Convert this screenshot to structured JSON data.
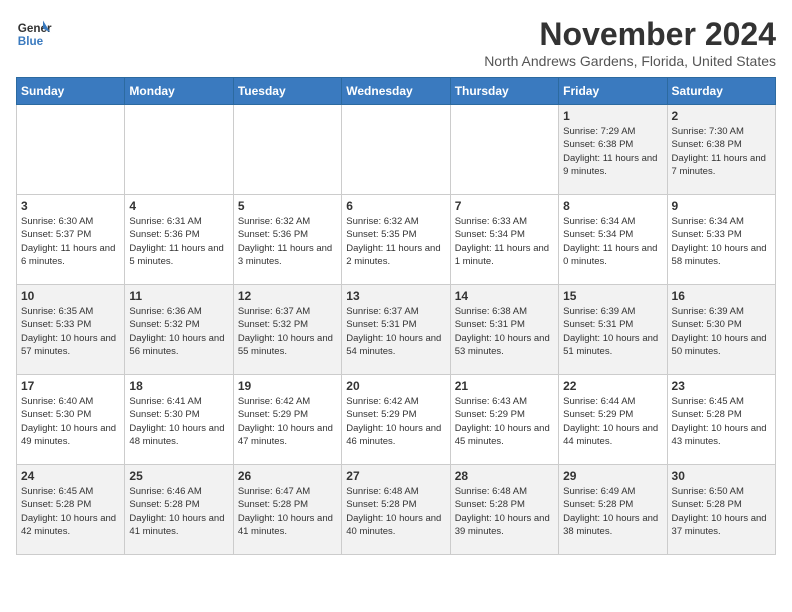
{
  "logo": {
    "line1": "General",
    "line2": "Blue"
  },
  "title": "November 2024",
  "subtitle": "North Andrews Gardens, Florida, United States",
  "days_of_week": [
    "Sunday",
    "Monday",
    "Tuesday",
    "Wednesday",
    "Thursday",
    "Friday",
    "Saturday"
  ],
  "weeks": [
    [
      {
        "day": "",
        "info": ""
      },
      {
        "day": "",
        "info": ""
      },
      {
        "day": "",
        "info": ""
      },
      {
        "day": "",
        "info": ""
      },
      {
        "day": "",
        "info": ""
      },
      {
        "day": "1",
        "info": "Sunrise: 7:29 AM\nSunset: 6:38 PM\nDaylight: 11 hours and 9 minutes."
      },
      {
        "day": "2",
        "info": "Sunrise: 7:30 AM\nSunset: 6:38 PM\nDaylight: 11 hours and 7 minutes."
      }
    ],
    [
      {
        "day": "3",
        "info": "Sunrise: 6:30 AM\nSunset: 5:37 PM\nDaylight: 11 hours and 6 minutes."
      },
      {
        "day": "4",
        "info": "Sunrise: 6:31 AM\nSunset: 5:36 PM\nDaylight: 11 hours and 5 minutes."
      },
      {
        "day": "5",
        "info": "Sunrise: 6:32 AM\nSunset: 5:36 PM\nDaylight: 11 hours and 3 minutes."
      },
      {
        "day": "6",
        "info": "Sunrise: 6:32 AM\nSunset: 5:35 PM\nDaylight: 11 hours and 2 minutes."
      },
      {
        "day": "7",
        "info": "Sunrise: 6:33 AM\nSunset: 5:34 PM\nDaylight: 11 hours and 1 minute."
      },
      {
        "day": "8",
        "info": "Sunrise: 6:34 AM\nSunset: 5:34 PM\nDaylight: 11 hours and 0 minutes."
      },
      {
        "day": "9",
        "info": "Sunrise: 6:34 AM\nSunset: 5:33 PM\nDaylight: 10 hours and 58 minutes."
      }
    ],
    [
      {
        "day": "10",
        "info": "Sunrise: 6:35 AM\nSunset: 5:33 PM\nDaylight: 10 hours and 57 minutes."
      },
      {
        "day": "11",
        "info": "Sunrise: 6:36 AM\nSunset: 5:32 PM\nDaylight: 10 hours and 56 minutes."
      },
      {
        "day": "12",
        "info": "Sunrise: 6:37 AM\nSunset: 5:32 PM\nDaylight: 10 hours and 55 minutes."
      },
      {
        "day": "13",
        "info": "Sunrise: 6:37 AM\nSunset: 5:31 PM\nDaylight: 10 hours and 54 minutes."
      },
      {
        "day": "14",
        "info": "Sunrise: 6:38 AM\nSunset: 5:31 PM\nDaylight: 10 hours and 53 minutes."
      },
      {
        "day": "15",
        "info": "Sunrise: 6:39 AM\nSunset: 5:31 PM\nDaylight: 10 hours and 51 minutes."
      },
      {
        "day": "16",
        "info": "Sunrise: 6:39 AM\nSunset: 5:30 PM\nDaylight: 10 hours and 50 minutes."
      }
    ],
    [
      {
        "day": "17",
        "info": "Sunrise: 6:40 AM\nSunset: 5:30 PM\nDaylight: 10 hours and 49 minutes."
      },
      {
        "day": "18",
        "info": "Sunrise: 6:41 AM\nSunset: 5:30 PM\nDaylight: 10 hours and 48 minutes."
      },
      {
        "day": "19",
        "info": "Sunrise: 6:42 AM\nSunset: 5:29 PM\nDaylight: 10 hours and 47 minutes."
      },
      {
        "day": "20",
        "info": "Sunrise: 6:42 AM\nSunset: 5:29 PM\nDaylight: 10 hours and 46 minutes."
      },
      {
        "day": "21",
        "info": "Sunrise: 6:43 AM\nSunset: 5:29 PM\nDaylight: 10 hours and 45 minutes."
      },
      {
        "day": "22",
        "info": "Sunrise: 6:44 AM\nSunset: 5:29 PM\nDaylight: 10 hours and 44 minutes."
      },
      {
        "day": "23",
        "info": "Sunrise: 6:45 AM\nSunset: 5:28 PM\nDaylight: 10 hours and 43 minutes."
      }
    ],
    [
      {
        "day": "24",
        "info": "Sunrise: 6:45 AM\nSunset: 5:28 PM\nDaylight: 10 hours and 42 minutes."
      },
      {
        "day": "25",
        "info": "Sunrise: 6:46 AM\nSunset: 5:28 PM\nDaylight: 10 hours and 41 minutes."
      },
      {
        "day": "26",
        "info": "Sunrise: 6:47 AM\nSunset: 5:28 PM\nDaylight: 10 hours and 41 minutes."
      },
      {
        "day": "27",
        "info": "Sunrise: 6:48 AM\nSunset: 5:28 PM\nDaylight: 10 hours and 40 minutes."
      },
      {
        "day": "28",
        "info": "Sunrise: 6:48 AM\nSunset: 5:28 PM\nDaylight: 10 hours and 39 minutes."
      },
      {
        "day": "29",
        "info": "Sunrise: 6:49 AM\nSunset: 5:28 PM\nDaylight: 10 hours and 38 minutes."
      },
      {
        "day": "30",
        "info": "Sunrise: 6:50 AM\nSunset: 5:28 PM\nDaylight: 10 hours and 37 minutes."
      }
    ]
  ]
}
